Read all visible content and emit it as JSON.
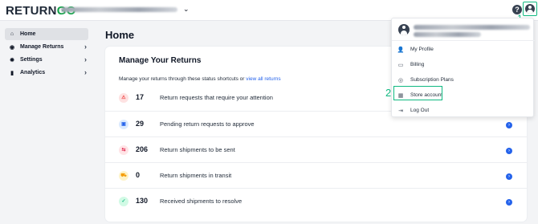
{
  "app": {
    "logo_main": "RETURN",
    "logo_accent": "GO"
  },
  "header": {
    "store_selector": "",
    "help_glyph": "?",
    "step1": "1"
  },
  "sidebar": {
    "items": [
      {
        "label": "Home",
        "icon": "home-icon",
        "glyph": "⌂",
        "active": true
      },
      {
        "label": "Manage Returns",
        "icon": "returns-icon",
        "glyph": "◉",
        "active": false
      },
      {
        "label": "Settings",
        "icon": "gear-icon",
        "glyph": "✹",
        "active": false
      },
      {
        "label": "Analytics",
        "icon": "bar-chart-icon",
        "glyph": "▮",
        "active": false
      }
    ],
    "arrow": "›"
  },
  "page": {
    "title": "Home"
  },
  "card": {
    "title": "Manage Your Returns",
    "description": "Manage your returns through these status shortcuts or",
    "link": "view all returns",
    "rows": [
      {
        "count": "17",
        "label": "Return requests that require your attention",
        "icon": "warning-icon",
        "glyph": "⚠",
        "color": "#ef4444",
        "bg": "#fee2e2"
      },
      {
        "count": "29",
        "label": "Pending return requests to approve",
        "icon": "pending-icon",
        "glyph": "▣",
        "color": "#2563eb",
        "bg": "#dbeafe"
      },
      {
        "count": "206",
        "label": "Return shipments to be sent",
        "icon": "shipment-send-icon",
        "glyph": "⇆",
        "color": "#e11d48",
        "bg": "#ffe4e6"
      },
      {
        "count": "0",
        "label": "Return shipments in transit",
        "icon": "truck-icon",
        "glyph": "⛟",
        "color": "#f59e0b",
        "bg": "#fef3c7"
      },
      {
        "count": "130",
        "label": "Received shipments to resolve",
        "icon": "received-icon",
        "glyph": "✓",
        "color": "#10b981",
        "bg": "#d1fae5"
      }
    ],
    "row_arrow": "›"
  },
  "dropdown": {
    "items": [
      {
        "label": "My Profile",
        "icon": "user-icon",
        "glyph": "👤"
      },
      {
        "label": "Billing",
        "icon": "billing-icon",
        "glyph": "▭"
      },
      {
        "label": "Subscription Plans",
        "icon": "plans-icon",
        "glyph": "◎"
      },
      {
        "label": "Store account",
        "icon": "store-icon",
        "glyph": "▦"
      },
      {
        "label": "Log Out",
        "icon": "logout-icon",
        "glyph": "⇥"
      }
    ],
    "step2": "2"
  },
  "colors": {
    "accent": "#10b981",
    "link": "#2563eb",
    "logo_green": "#16a34a"
  }
}
